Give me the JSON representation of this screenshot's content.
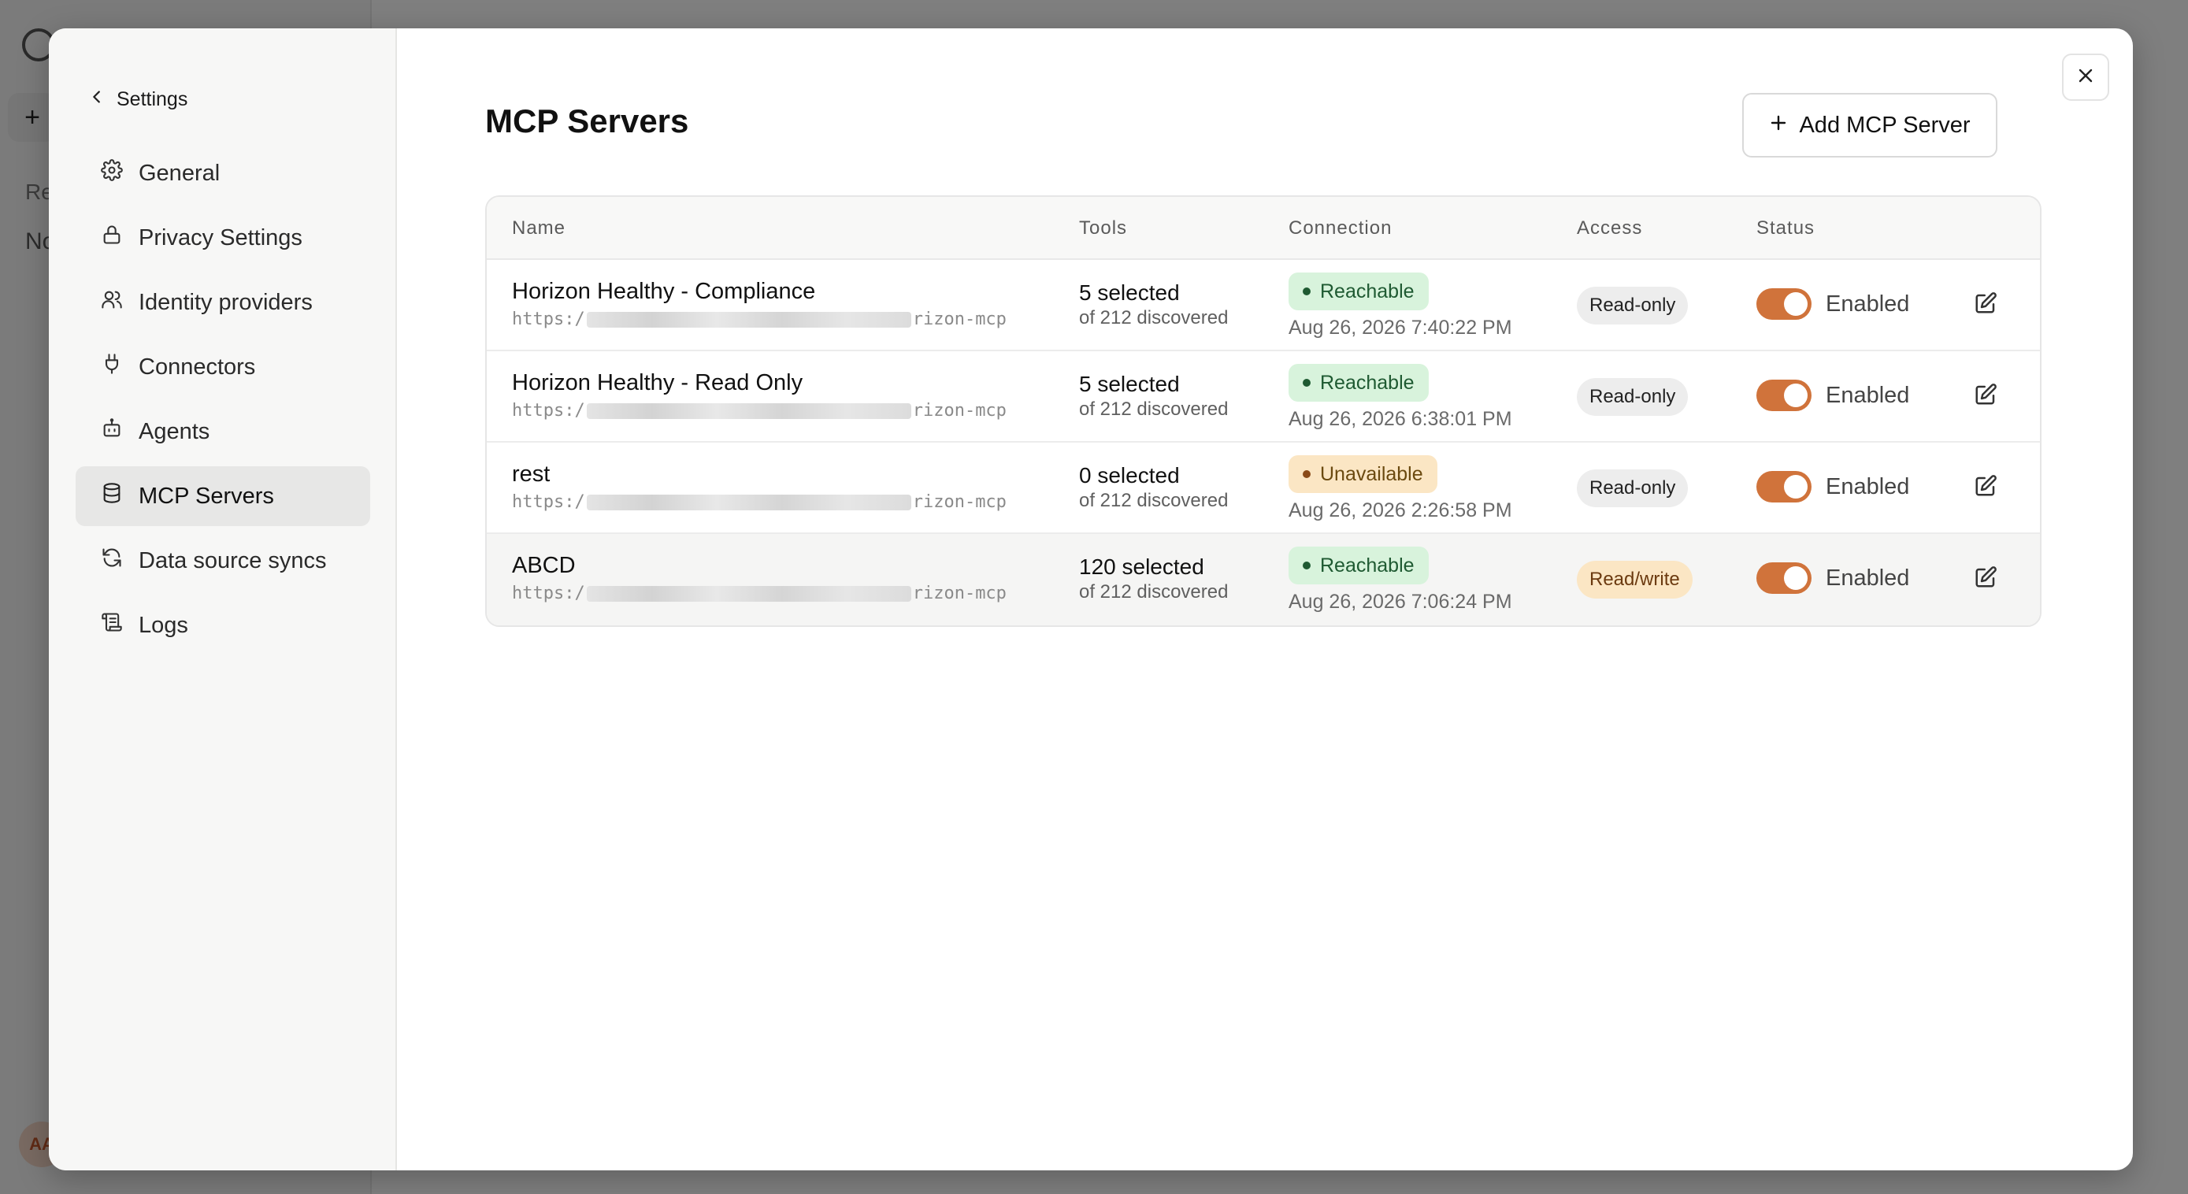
{
  "background": {
    "plus_label": "+",
    "sidebar_text_1": "Re",
    "sidebar_text_2": "No",
    "avatar_initials": "AA"
  },
  "modal": {
    "back_label": "Settings",
    "close_icon": "close-icon",
    "nav": [
      {
        "label": "General",
        "icon": "gear-icon",
        "active": false
      },
      {
        "label": "Privacy Settings",
        "icon": "lock-icon",
        "active": false
      },
      {
        "label": "Identity providers",
        "icon": "users-icon",
        "active": false
      },
      {
        "label": "Connectors",
        "icon": "plug-icon",
        "active": false
      },
      {
        "label": "Agents",
        "icon": "bot-icon",
        "active": false
      },
      {
        "label": "MCP Servers",
        "icon": "database-icon",
        "active": true
      },
      {
        "label": "Data source syncs",
        "icon": "refresh-icon",
        "active": false
      },
      {
        "label": "Logs",
        "icon": "scroll-icon",
        "active": false
      }
    ]
  },
  "main": {
    "title": "MCP Servers",
    "add_button_label": "Add MCP Server",
    "table": {
      "columns": {
        "name": "Name",
        "tools": "Tools",
        "connection": "Connection",
        "access": "Access",
        "status": "Status"
      },
      "rows": [
        {
          "name": "Horizon Healthy - Compliance",
          "url_prefix": "https:/",
          "url_suffix": "rizon-mcp",
          "tools_selected": "5 selected",
          "tools_discovered": "of 212 discovered",
          "connection": "Reachable",
          "connection_state": "ok",
          "connection_time": "Aug 26, 2026 7:40:22 PM",
          "access": "Read-only",
          "access_type": "ro",
          "status": "Enabled"
        },
        {
          "name": "Horizon Healthy - Read Only",
          "url_prefix": "https:/",
          "url_suffix": "rizon-mcp",
          "tools_selected": "5 selected",
          "tools_discovered": "of 212 discovered",
          "connection": "Reachable",
          "connection_state": "ok",
          "connection_time": "Aug 26, 2026 6:38:01 PM",
          "access": "Read-only",
          "access_type": "ro",
          "status": "Enabled"
        },
        {
          "name": "rest",
          "url_prefix": "https:/",
          "url_suffix": "rizon-mcp",
          "tools_selected": "0 selected",
          "tools_discovered": "of 212 discovered",
          "connection": "Unavailable",
          "connection_state": "warn",
          "connection_time": "Aug 26, 2026 2:26:58 PM",
          "access": "Read-only",
          "access_type": "ro",
          "status": "Enabled"
        },
        {
          "name": "ABCD",
          "url_prefix": "https:/",
          "url_suffix": "rizon-mcp",
          "tools_selected": "120 selected",
          "tools_discovered": "of 212 discovered",
          "connection": "Reachable",
          "connection_state": "ok",
          "connection_time": "Aug 26, 2026 7:06:24 PM",
          "access": "Read/write",
          "access_type": "rw",
          "status": "Enabled"
        }
      ]
    }
  },
  "colors": {
    "accent_toggle": "#d0733b",
    "reachable_bg": "#d8f3dc",
    "unavailable_bg": "#fbe6c4",
    "readwrite_bg": "#fbe6c4"
  }
}
